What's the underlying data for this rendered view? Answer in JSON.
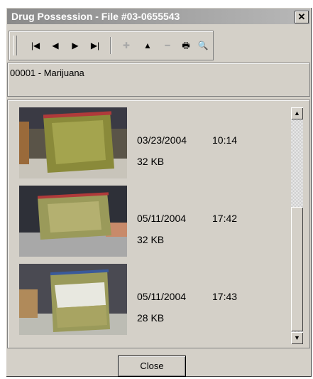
{
  "window": {
    "title": "Drug Possession - File #03-0655543",
    "close_glyph": "✕"
  },
  "toolbar": {
    "buttons": [
      {
        "icon": "first-record-icon",
        "glyph": "|◀",
        "enabled": true
      },
      {
        "icon": "previous-record-icon",
        "glyph": "◀",
        "enabled": true
      },
      {
        "icon": "next-record-icon",
        "glyph": "▶",
        "enabled": true
      },
      {
        "icon": "last-record-icon",
        "glyph": "▶|",
        "enabled": true
      },
      {
        "icon": "add-icon",
        "glyph": "✚",
        "enabled": false
      },
      {
        "icon": "move-up-icon",
        "glyph": "▲",
        "enabled": true
      },
      {
        "icon": "remove-icon",
        "glyph": "━",
        "enabled": false
      },
      {
        "icon": "print-icon",
        "glyph": "🖶",
        "enabled": true
      },
      {
        "icon": "print-preview-icon",
        "glyph": "🔍",
        "enabled": true
      }
    ]
  },
  "record": {
    "label": "00001 - Marijuana"
  },
  "attachments": [
    {
      "date": "03/23/2004",
      "time": "10:14",
      "size": "32 KB"
    },
    {
      "date": "05/11/2004",
      "time": "17:42",
      "size": "32 KB"
    },
    {
      "date": "05/11/2004",
      "time": "17:43",
      "size": "28 KB"
    }
  ],
  "scrollbar": {
    "up_glyph": "▲",
    "down_glyph": "▼"
  },
  "footer": {
    "close_label": "Close"
  },
  "colors": {
    "chrome": "#d4d0c8",
    "titlebar": "#8a8a8a",
    "bag_green": "#8a8a3a",
    "bag_seal": "#b03a3a"
  }
}
